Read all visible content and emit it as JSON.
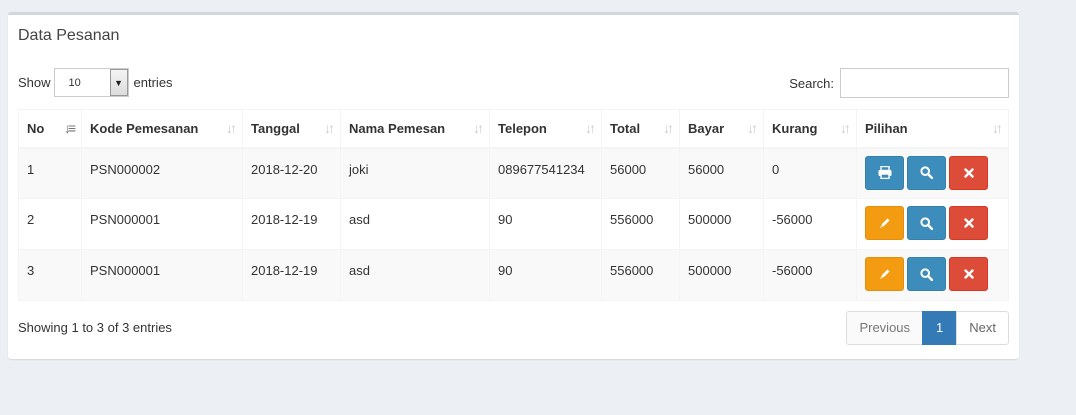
{
  "box": {
    "title": "Data Pesanan"
  },
  "length": {
    "show_label": "Show",
    "value": "10",
    "entries_label": "entries"
  },
  "search": {
    "label": "Search:",
    "value": ""
  },
  "table": {
    "headers": [
      "No",
      "Kode Pemesanan",
      "Tanggal",
      "Nama Pemesan",
      "Telepon",
      "Total",
      "Bayar",
      "Kurang",
      "Pilihan"
    ],
    "rows": [
      {
        "no": "1",
        "kode": "PSN000002",
        "tanggal": "2018-12-20",
        "nama": "joki",
        "telepon": "089677541234",
        "total": "56000",
        "bayar": "56000",
        "kurang": "0",
        "first_action": "print-icon"
      },
      {
        "no": "2",
        "kode": "PSN000001",
        "tanggal": "2018-12-19",
        "nama": "asd",
        "telepon": "90",
        "total": "556000",
        "bayar": "500000",
        "kurang": "-56000",
        "first_action": "edit-icon"
      },
      {
        "no": "3",
        "kode": "PSN000001",
        "tanggal": "2018-12-19",
        "nama": "asd",
        "telepon": "90",
        "total": "556000",
        "bayar": "500000",
        "kurang": "-56000",
        "first_action": "edit-icon"
      }
    ]
  },
  "footer": {
    "info": "Showing 1 to 3 of 3 entries",
    "previous": "Previous",
    "current_page": "1",
    "next": "Next"
  },
  "colors": {
    "primary": "#3c8dbc",
    "warning": "#f39c12",
    "danger": "#dd4b39",
    "page_active": "#337ab7",
    "background": "#ecf0f5"
  }
}
